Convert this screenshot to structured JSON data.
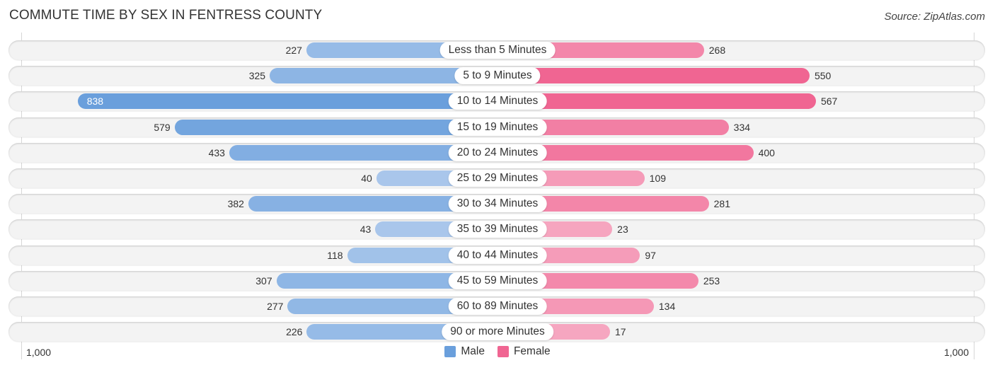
{
  "header": {
    "title": "COMMUTE TIME BY SEX IN FENTRESS COUNTY",
    "source": "Source: ZipAtlas.com"
  },
  "colors": {
    "male": "#6a9fdc",
    "male_light": "#adc9ec",
    "female": "#f06592",
    "female_light": "#f6a8c1"
  },
  "chart_data": {
    "type": "bar",
    "orientation": "horizontal-diverging",
    "title": "COMMUTE TIME BY SEX IN FENTRESS COUNTY",
    "categories": [
      "Less than 5 Minutes",
      "5 to 9 Minutes",
      "10 to 14 Minutes",
      "15 to 19 Minutes",
      "20 to 24 Minutes",
      "25 to 29 Minutes",
      "30 to 34 Minutes",
      "35 to 39 Minutes",
      "40 to 44 Minutes",
      "45 to 59 Minutes",
      "60 to 89 Minutes",
      "90 or more Minutes"
    ],
    "series": [
      {
        "name": "Male",
        "values": [
          227,
          325,
          838,
          579,
          433,
          40,
          382,
          43,
          118,
          307,
          277,
          226
        ]
      },
      {
        "name": "Female",
        "values": [
          268,
          550,
          567,
          334,
          400,
          109,
          281,
          23,
          97,
          253,
          134,
          17
        ]
      }
    ],
    "axis": {
      "left_label": "1,000",
      "right_label": "1,000",
      "range": [
        -1000,
        1000
      ]
    },
    "legend": {
      "entries": [
        "Male",
        "Female"
      ],
      "placement": "bottom-center"
    },
    "grid": false
  }
}
